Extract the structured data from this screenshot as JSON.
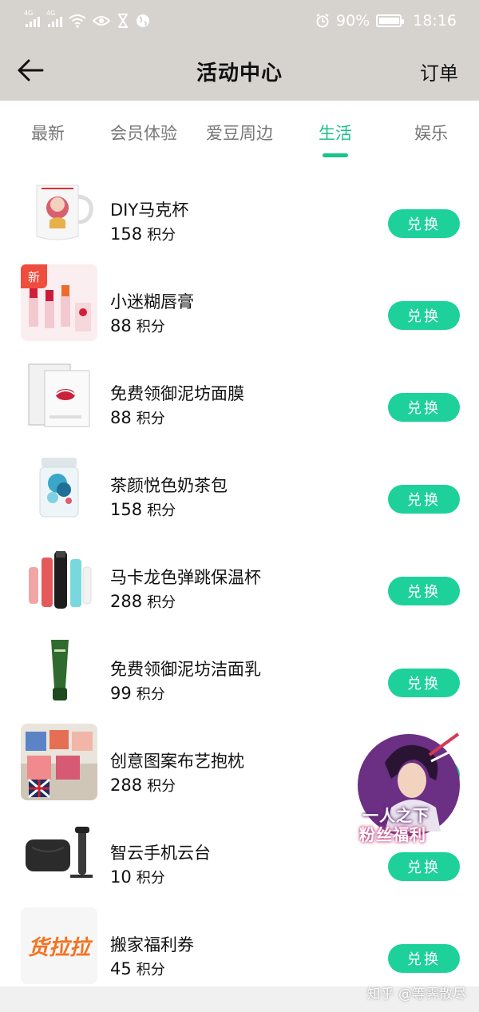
{
  "status_bar": {
    "network": "4G",
    "battery": "90%",
    "time": "18:16"
  },
  "nav": {
    "title": "活动中心",
    "right_label": "订单",
    "back_icon": "arrow-left-icon"
  },
  "tabs": [
    {
      "label": "最新",
      "active": false
    },
    {
      "label": "会员体验",
      "active": false
    },
    {
      "label": "爱豆周边",
      "active": false
    },
    {
      "label": "生活",
      "active": true
    },
    {
      "label": "娱乐",
      "active": false
    }
  ],
  "items": [
    {
      "name": "DIY马克杯",
      "points": "158",
      "unit": "积分",
      "action": "兑换"
    },
    {
      "name": "小迷糊唇膏",
      "points": "88",
      "unit": "积分",
      "action": "兑换",
      "badge": "新"
    },
    {
      "name": "免费领御泥坊面膜",
      "points": "88",
      "unit": "积分",
      "action": "兑换"
    },
    {
      "name": "茶颜悦色奶茶包",
      "points": "158",
      "unit": "积分",
      "action": "兑换"
    },
    {
      "name": "马卡龙色弹跳保温杯",
      "points": "288",
      "unit": "积分",
      "action": "兑换"
    },
    {
      "name": "免费领御泥坊洁面乳",
      "points": "99",
      "unit": "积分",
      "action": "兑换"
    },
    {
      "name": "创意图案布艺抱枕",
      "points": "288",
      "unit": "积分",
      "action": "兑换"
    },
    {
      "name": "智云手机云台",
      "points": "10",
      "unit": "积分",
      "action": "兑换"
    },
    {
      "name": "搬家福利券",
      "points": "45",
      "unit": "积分",
      "action": "兑换"
    }
  ],
  "float_banner": {
    "line1": "一人之下",
    "line2": "粉丝福利"
  },
  "thumb_text": {
    "huolala": "货拉拉"
  },
  "watermark": "知乎 @等霁散尽",
  "colors": {
    "accent": "#1cc28c",
    "button": "#1ed19b",
    "badge": "#ef4d3e",
    "header_bg": "#d6d3ce"
  }
}
